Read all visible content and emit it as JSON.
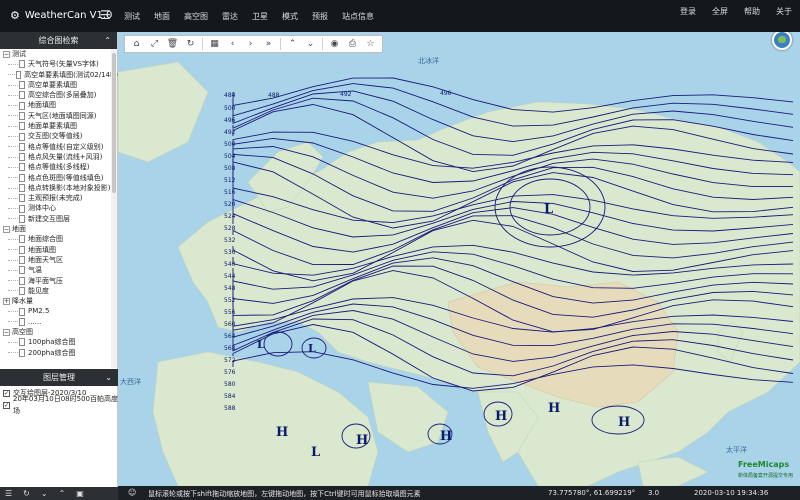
{
  "app": {
    "title": "WeatherCan V1.0"
  },
  "nav": {
    "items": [
      "测试",
      "地面",
      "高空图",
      "雷达",
      "卫星",
      "模式",
      "预报",
      "站点信息"
    ],
    "right": [
      "登录",
      "全屏",
      "帮助",
      "关于"
    ]
  },
  "left_panel": {
    "title": "综合图检索",
    "tree": [
      {
        "label": "测试",
        "kind": "folder",
        "expanded": true
      },
      {
        "label": "天气符号(矢量VS字体)",
        "kind": "item"
      },
      {
        "label": "高空单要素填图(测试02/14H)",
        "kind": "item"
      },
      {
        "label": "高空单要素填图",
        "kind": "item"
      },
      {
        "label": "高空综合图(多层叠加)",
        "kind": "item"
      },
      {
        "label": "地面填图",
        "kind": "item"
      },
      {
        "label": "天气区(地面填图同源)",
        "kind": "item"
      },
      {
        "label": "地面单要素填图",
        "kind": "item"
      },
      {
        "label": "交互图(交等值线)",
        "kind": "item"
      },
      {
        "label": "格点等值线(自定义级别)",
        "kind": "item"
      },
      {
        "label": "格点风矢量(流线+风羽)",
        "kind": "item"
      },
      {
        "label": "格点等值线(多线程)",
        "kind": "item"
      },
      {
        "label": "格点色斑图(等值线填色)",
        "kind": "item"
      },
      {
        "label": "格点转换影(本地对象投影)",
        "kind": "item"
      },
      {
        "label": "主观预报(未完成)",
        "kind": "item"
      },
      {
        "label": "测体中心",
        "kind": "item"
      },
      {
        "label": "新建交互图层",
        "kind": "item"
      },
      {
        "label": "地面",
        "kind": "folder",
        "expanded": true
      },
      {
        "label": "地面综合图",
        "kind": "item"
      },
      {
        "label": "地面填图",
        "kind": "item"
      },
      {
        "label": "地面天气区",
        "kind": "item"
      },
      {
        "label": "气温",
        "kind": "item"
      },
      {
        "label": "海平面气压",
        "kind": "item"
      },
      {
        "label": "能见度",
        "kind": "item"
      },
      {
        "label": "降水量",
        "kind": "folder",
        "expanded": false
      },
      {
        "label": "PM2.5",
        "kind": "item"
      },
      {
        "label": "......",
        "kind": "item"
      },
      {
        "label": "高空图",
        "kind": "folder",
        "expanded": true
      },
      {
        "label": "100pha综合图",
        "kind": "item"
      },
      {
        "label": "200pha综合图",
        "kind": "item"
      }
    ],
    "layers_title": "图层管理",
    "layers": [
      {
        "label": "交互绘图层-2020/3/10",
        "checked": true
      },
      {
        "label": "20年03月10日08时500百帕高度场",
        "checked": true
      }
    ],
    "footer_icons": [
      "menu-icon",
      "refresh-icon",
      "expand-icon",
      "collapse-icon",
      "lock-icon"
    ]
  },
  "toolbar": {
    "icons": [
      "home-icon",
      "fullscreen-icon",
      "delete-icon",
      "refresh-icon",
      "grid-icon",
      "prev-icon",
      "next-icon",
      "last-icon",
      "up-icon",
      "down-icon",
      "camera-icon",
      "print-icon",
      "star-icon"
    ]
  },
  "map": {
    "ocean_labels": [
      "北冰洋",
      "大西洋",
      "太平洋"
    ],
    "contour_labels": [
      "484",
      "488",
      "492",
      "496",
      "500",
      "496",
      "492",
      "500",
      "504",
      "508",
      "512",
      "516",
      "520",
      "524",
      "528",
      "532",
      "536",
      "540",
      "544",
      "548",
      "552",
      "556",
      "560",
      "564",
      "568",
      "572",
      "576",
      "580",
      "584",
      "588"
    ],
    "highs": [
      "H",
      "H",
      "H",
      "H",
      "H",
      "H"
    ],
    "lows": [
      "L",
      "L",
      "L",
      "L"
    ],
    "colors": {
      "ocean": "#a9d3e9",
      "land": "#d9e8cf",
      "contour": "#1a1a7a"
    }
  },
  "status": {
    "message": "鼠标滚轮或按下shift拖动缩放地图，左键拖动地图，按下Ctrl键时可用鼠标拾取填图元素",
    "coordinate": "73.775780°, 61.699219°",
    "zoom": "3.0",
    "time": "2020-03-10 19:34:36",
    "watermark": "FreeMicaps",
    "watermark_sub": "新体局备案开源提交专用"
  }
}
